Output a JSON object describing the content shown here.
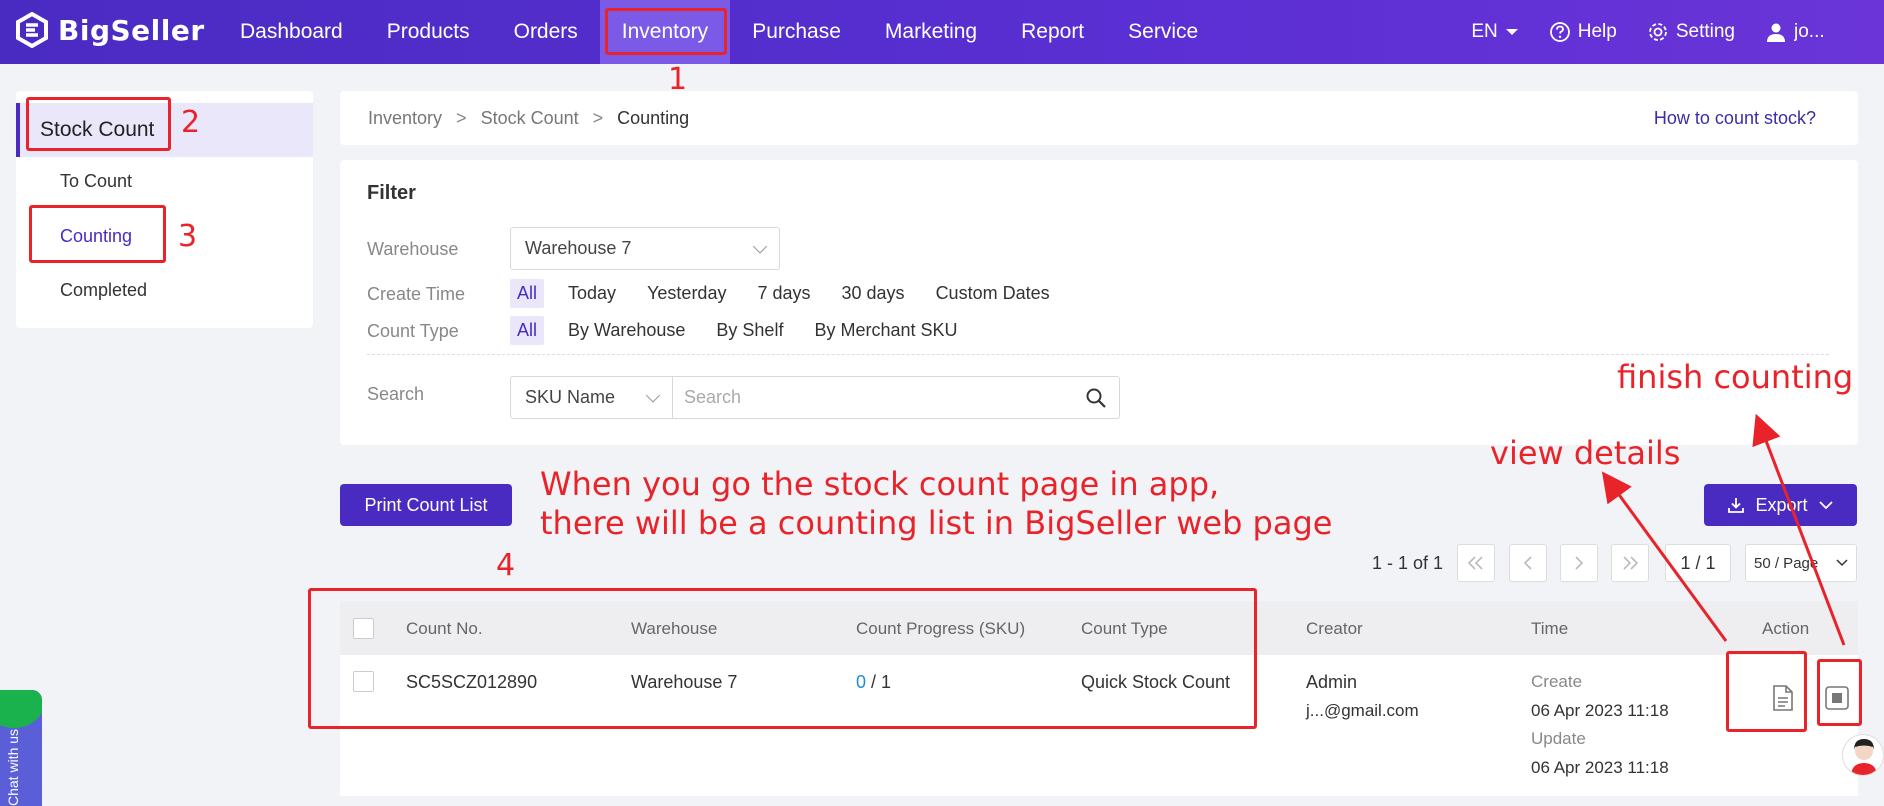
{
  "app": {
    "brand": "BigSeller",
    "nav": [
      "Dashboard",
      "Products",
      "Orders",
      "Inventory",
      "Purchase",
      "Marketing",
      "Report",
      "Service"
    ],
    "active_nav": "Inventory",
    "lang": "EN",
    "help": "Help",
    "setting": "Setting",
    "user": "jo..."
  },
  "sidebar": {
    "header": "Stock Count",
    "items": [
      "To Count",
      "Counting",
      "Completed"
    ],
    "active": "Counting"
  },
  "breadcrumb": {
    "items": [
      "Inventory",
      "Stock Count",
      "Counting"
    ],
    "separator": ">",
    "help_link": "How to count stock?"
  },
  "filter": {
    "title": "Filter",
    "warehouse": {
      "label": "Warehouse",
      "value": "Warehouse 7"
    },
    "create_time": {
      "label": "Create Time",
      "options": [
        "All",
        "Today",
        "Yesterday",
        "7 days",
        "30 days",
        "Custom Dates"
      ],
      "selected": "All"
    },
    "count_type": {
      "label": "Count Type",
      "options": [
        "All",
        "By Warehouse",
        "By Shelf",
        "By Merchant SKU"
      ],
      "selected": "All"
    },
    "search": {
      "label": "Search",
      "field": "SKU Name",
      "placeholder": "Search"
    }
  },
  "toolbar": {
    "print_label": "Print Count List",
    "export_label": "Export"
  },
  "pagination": {
    "info": "1 - 1 of 1",
    "page": "1 / 1",
    "page_size": "50 / Page"
  },
  "table": {
    "columns": [
      "Count No.",
      "Warehouse",
      "Count Progress (SKU)",
      "Count Type",
      "Creator",
      "Time",
      "Action"
    ],
    "rows": [
      {
        "count_no": "SC5SCZ012890",
        "warehouse": "Warehouse 7",
        "progress_done": "0",
        "progress_total": "/ 1",
        "count_type": "Quick Stock Count",
        "creator_name": "Admin",
        "creator_email": "j...@gmail.com",
        "create_label": "Create",
        "create_time": "06 Apr 2023 11:18",
        "update_label": "Update",
        "update_time": "06 Apr 2023 11:18"
      }
    ]
  },
  "annotations": {
    "n1": "1",
    "n2": "2",
    "n3": "3",
    "n4": "4",
    "note_line1": "When you go the stock count page in app,",
    "note_line2": "there will be a counting list in BigSeller web page",
    "view_details": "view details",
    "finish_counting": "finish counting"
  },
  "chat": {
    "label": "Chat with us"
  },
  "colors": {
    "brand": "#4a2bc2",
    "annotation": "#e8232a",
    "progress": "#1a8fd8"
  },
  "icons": {
    "logo": "bigseller-logo-icon",
    "lang_dropdown": "caret-down-icon",
    "help": "question-circle-icon",
    "setting": "gear-icon",
    "user": "user-icon",
    "search": "search-icon",
    "export": "download-icon",
    "view": "document-icon",
    "finish": "stop-square-icon"
  }
}
